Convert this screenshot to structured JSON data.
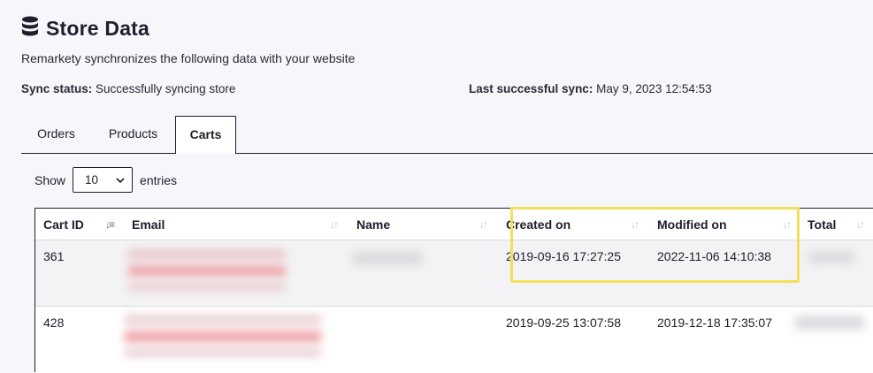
{
  "header": {
    "icon": "database-icon",
    "title": "Store Data",
    "subtitle": "Remarkety synchronizes the following data with your website"
  },
  "status": {
    "sync_label": "Sync status:",
    "sync_value": "Successfully syncing store",
    "last_label": "Last successful sync:",
    "last_value": "May 9, 2023 12:54:53"
  },
  "tabs": [
    {
      "label": "Orders",
      "active": false
    },
    {
      "label": "Products",
      "active": false
    },
    {
      "label": "Carts",
      "active": true
    }
  ],
  "length_control": {
    "show_label": "Show",
    "value": "10",
    "entries_label": "entries"
  },
  "table": {
    "columns": [
      "Cart ID",
      "Email",
      "Name",
      "Created on",
      "Modified on",
      "Total"
    ],
    "sorted_column": "Cart ID",
    "rows": [
      {
        "cart_id": "361",
        "email": "",
        "name": "",
        "created_on": "2019-09-16 17:27:25",
        "modified_on": "2022-11-06 14:10:38",
        "total": ""
      },
      {
        "cart_id": "428",
        "email": "",
        "name": "",
        "created_on": "2019-09-25 13:07:58",
        "modified_on": "2019-12-18 17:35:07",
        "total": ""
      }
    ]
  },
  "colors": {
    "highlight": "#f5df5a",
    "text": "#1e1e2c",
    "background": "#f6f7fb"
  }
}
